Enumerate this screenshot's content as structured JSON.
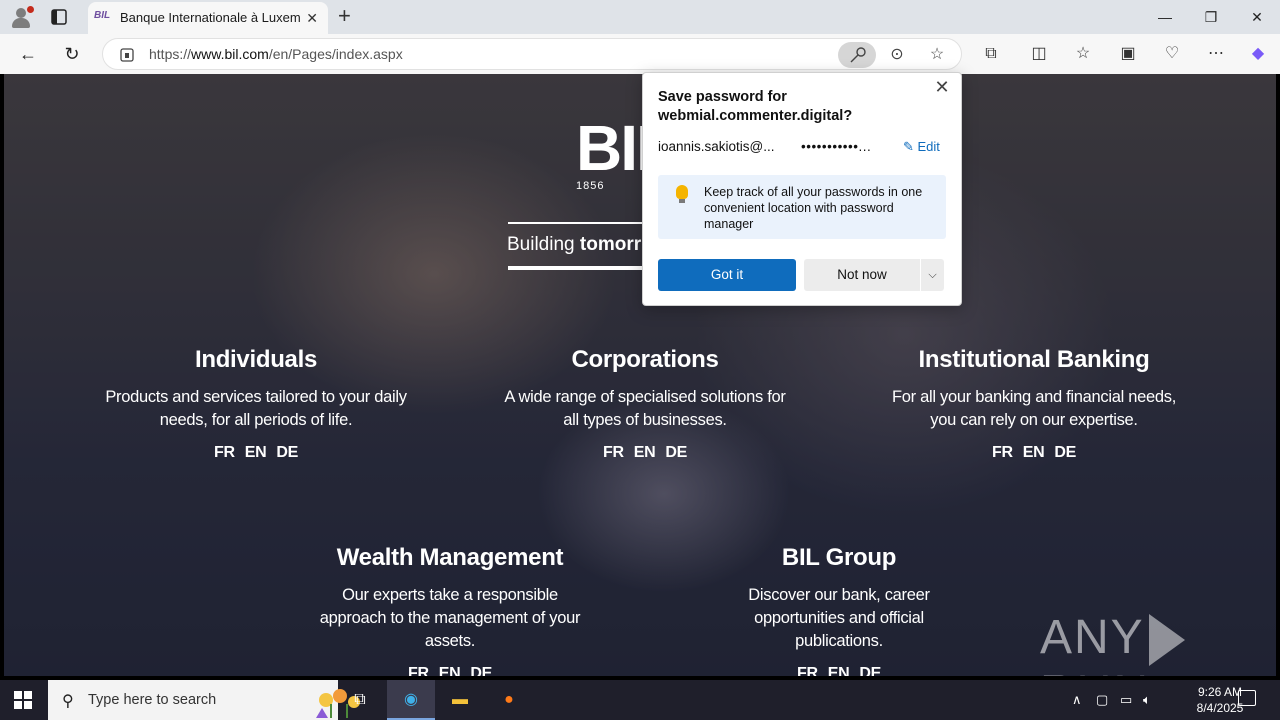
{
  "browser": {
    "tab_title": "Banque Internationale à Luxembo",
    "tab_favicon": "BIL",
    "url_prefix": "https://",
    "url_host": "www.bil.com",
    "url_path": "/en/Pages/index.aspx"
  },
  "page": {
    "logo_text": "BIL",
    "logo_year": "1856",
    "slogan_normal": "Building ",
    "slogan_bold": "tomorr",
    "sections": [
      {
        "title": "Individuals",
        "desc": "Products and services tailored to your daily needs, for all periods of life."
      },
      {
        "title": "Corporations",
        "desc": "A wide range of specialised solutions for all types of businesses."
      },
      {
        "title": "Institutional Banking",
        "desc": "For all your banking and financial needs, you can rely on our expertise."
      },
      {
        "title": "Wealth Management",
        "desc": "Our experts take a responsible approach to the management of your assets."
      },
      {
        "title": "BIL Group",
        "desc": "Discover our bank, career opportunities and official publications."
      }
    ],
    "languages": [
      "FR",
      "EN",
      "DE"
    ],
    "watermark_left": "ANY",
    "watermark_right": "RUN"
  },
  "password_popup": {
    "title": "Save password for webmial.commenter.digital?",
    "username": "ioannis.sakiotis@...",
    "password": "•••••••••••...",
    "edit_label": "Edit",
    "tip": "Keep track of all your passwords in one convenient location with password manager",
    "got_it_label": "Got it",
    "not_now_label": "Not now"
  },
  "taskbar": {
    "search_placeholder": "Type here to search",
    "time": "9:26 AM",
    "date": "8/4/2025"
  },
  "colors": {
    "accent": "#0f6cbd",
    "tip_bg": "#eaf2fc",
    "taskbar": "#1f1f2b"
  }
}
